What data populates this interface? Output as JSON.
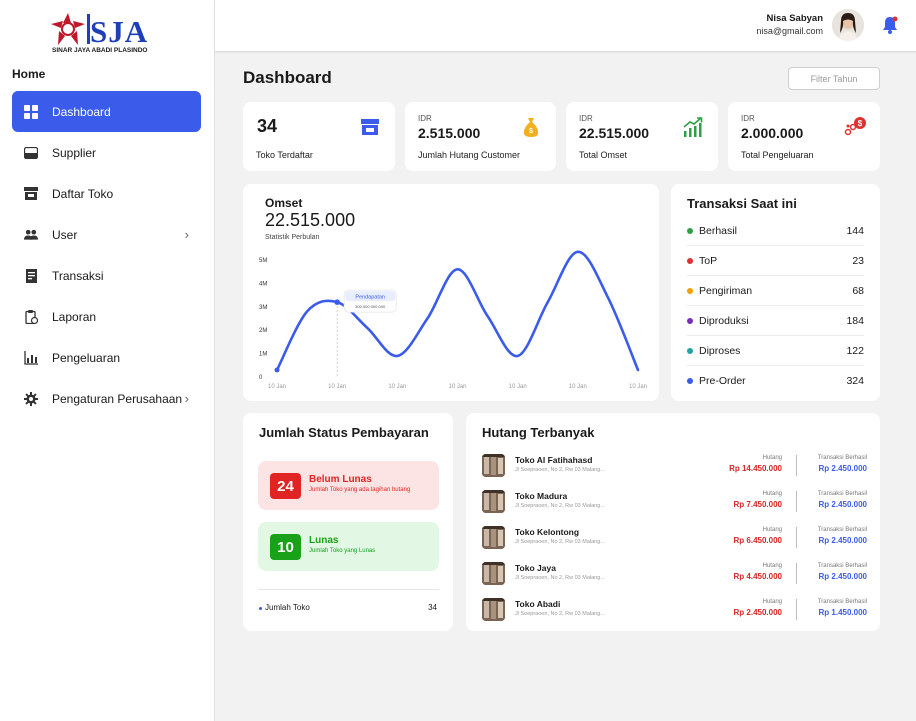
{
  "brand": {
    "name": "SJA",
    "subtitle": "SINAR JAYA ABADI PLASINDO"
  },
  "sidebar": {
    "section_label": "Home",
    "items": [
      {
        "label": "Dashboard",
        "icon": "grid-icon",
        "active": true
      },
      {
        "label": "Supplier",
        "icon": "inbox-icon"
      },
      {
        "label": "Daftar Toko",
        "icon": "store-icon"
      },
      {
        "label": "User",
        "icon": "users-icon",
        "has_submenu": true
      },
      {
        "label": "Transaksi",
        "icon": "receipt-icon"
      },
      {
        "label": "Laporan",
        "icon": "clipboard-icon"
      },
      {
        "label": "Pengeluaran",
        "icon": "chart-icon"
      },
      {
        "label": "Pengaturan Perusahaan",
        "icon": "gear-icon",
        "has_submenu": true
      }
    ]
  },
  "header": {
    "user_name": "Nisa Sabyan",
    "user_email": "nisa@gmail.com"
  },
  "page": {
    "title": "Dashboard",
    "filter_placeholder": "Filter Tahun"
  },
  "stats": [
    {
      "currency": "",
      "value": "34",
      "label": "Toko Terdaftar",
      "icon": "store-icon",
      "color": "#3b5bea"
    },
    {
      "currency": "IDR",
      "value": "2.515.000",
      "label": "Jumlah Hutang Customer",
      "icon": "money-bag-icon",
      "color": "#f2b01e"
    },
    {
      "currency": "IDR",
      "value": "22.515.000",
      "label": "Total Omset",
      "icon": "trend-up-icon",
      "color": "#2ea043"
    },
    {
      "currency": "IDR",
      "value": "2.000.000",
      "label": "Total Pengeluaran",
      "icon": "coins-icon",
      "color": "#e03131"
    }
  ],
  "omset": {
    "title": "Omset",
    "value": "22.515.000",
    "subtitle": "Statistik Perbulan",
    "tooltip_title": "Pendapatan",
    "tooltip_value": "300.000.000.000"
  },
  "chart_data": {
    "type": "line",
    "title": "Omset",
    "x": [
      "10 Jan",
      "10 Jan",
      "10 Jan",
      "10 Jan",
      "10 Jan",
      "10 Jan",
      "10 Jan"
    ],
    "y_ticks": [
      "0",
      "1M",
      "2M",
      "3M",
      "4M",
      "5M"
    ],
    "ylim": [
      0,
      5.4
    ],
    "series": [
      {
        "points": [
          [
            0,
            0.3
          ],
          [
            0.5,
            2.8
          ],
          [
            1,
            3.2
          ],
          [
            1.5,
            2.1
          ],
          [
            2,
            0.9
          ],
          [
            2.5,
            2.5
          ],
          [
            3,
            4.6
          ],
          [
            3.5,
            2.6
          ],
          [
            4,
            0.9
          ],
          [
            4.5,
            3.2
          ],
          [
            5,
            5.8
          ],
          [
            5.5,
            3.4
          ],
          [
            6,
            0.3
          ]
        ]
      }
    ],
    "color": "#3b5bea",
    "grid": false
  },
  "transaksi": {
    "title": "Transaksi Saat ini",
    "items": [
      {
        "label": "Berhasil",
        "count": "144",
        "color": "#2ea043"
      },
      {
        "label": "ToP",
        "count": "23",
        "color": "#e03131"
      },
      {
        "label": "Pengiriman",
        "count": "68",
        "color": "#f59f00"
      },
      {
        "label": "Diproduksi",
        "count": "184",
        "color": "#7b2cbf"
      },
      {
        "label": "Diproses",
        "count": "122",
        "color": "#22a3a3"
      },
      {
        "label": "Pre-Order",
        "count": "324",
        "color": "#3b5bea"
      }
    ]
  },
  "status": {
    "title": "Jumlah Status Pembayaran",
    "belum": {
      "num": "24",
      "name": "Belum Lunas",
      "desc": "Jumlah Toko yang ada tagihan hutang"
    },
    "lunas": {
      "num": "10",
      "name": "Lunas",
      "desc": "Jumlah Toko yang Lunas"
    },
    "footer_label": "Jumlah Toko",
    "footer_value": "34"
  },
  "hutang": {
    "title": "Hutang Terbanyak",
    "hutang_label": "Hutang",
    "transaksi_label": "Transaksi Berhasil",
    "rows": [
      {
        "name": "Toko Al Fatihahasd",
        "address": "Jl Soepraoen, No 2, Rw 03 Malang...",
        "hutang": "Rp 14.450.000",
        "transaksi": "Rp 2.450.000"
      },
      {
        "name": "Toko Madura",
        "address": "Jl Soepraoen, No 2, Rw 03 Malang...",
        "hutang": "Rp 7.450.000",
        "transaksi": "Rp 2.450.000"
      },
      {
        "name": "Toko Kelontong",
        "address": "Jl Soepraoen, No 2, Rw 03 Malang...",
        "hutang": "Rp 6.450.000",
        "transaksi": "Rp 2.450.000"
      },
      {
        "name": "Toko Jaya",
        "address": "Jl Soepraoen, No 2, Rw 03 Malang...",
        "hutang": "Rp 4.450.000",
        "transaksi": "Rp 2.450.000"
      },
      {
        "name": "Toko Abadi",
        "address": "Jl Soepraoen, No 2, Rw 03 Malang...",
        "hutang": "Rp 2.450.000",
        "transaksi": "Rp 1.450.000"
      }
    ]
  }
}
